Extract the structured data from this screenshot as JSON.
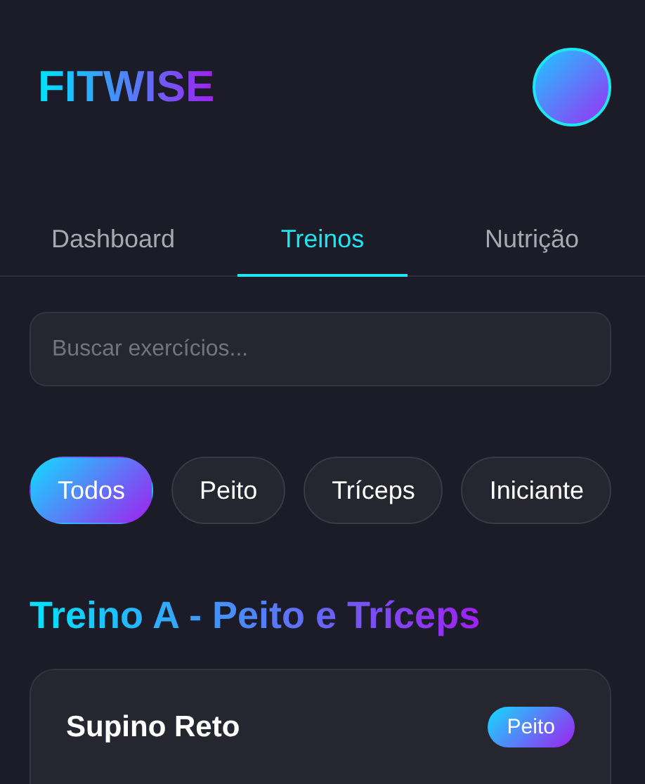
{
  "header": {
    "logo": "FITWISE"
  },
  "tabs": [
    {
      "label": "Dashboard",
      "selected": false
    },
    {
      "label": "Treinos",
      "selected": true
    },
    {
      "label": "Nutrição",
      "selected": false
    }
  ],
  "search": {
    "placeholder": "Buscar exercícios..."
  },
  "filters": [
    {
      "label": "Todos",
      "selected": true
    },
    {
      "label": "Peito",
      "selected": false
    },
    {
      "label": "Tríceps",
      "selected": false
    },
    {
      "label": "Iniciante",
      "selected": false
    }
  ],
  "section": {
    "title": "Treino A - Peito e Tríceps",
    "exercises": [
      {
        "name": "Supino Reto",
        "tag": "Peito"
      }
    ]
  }
}
